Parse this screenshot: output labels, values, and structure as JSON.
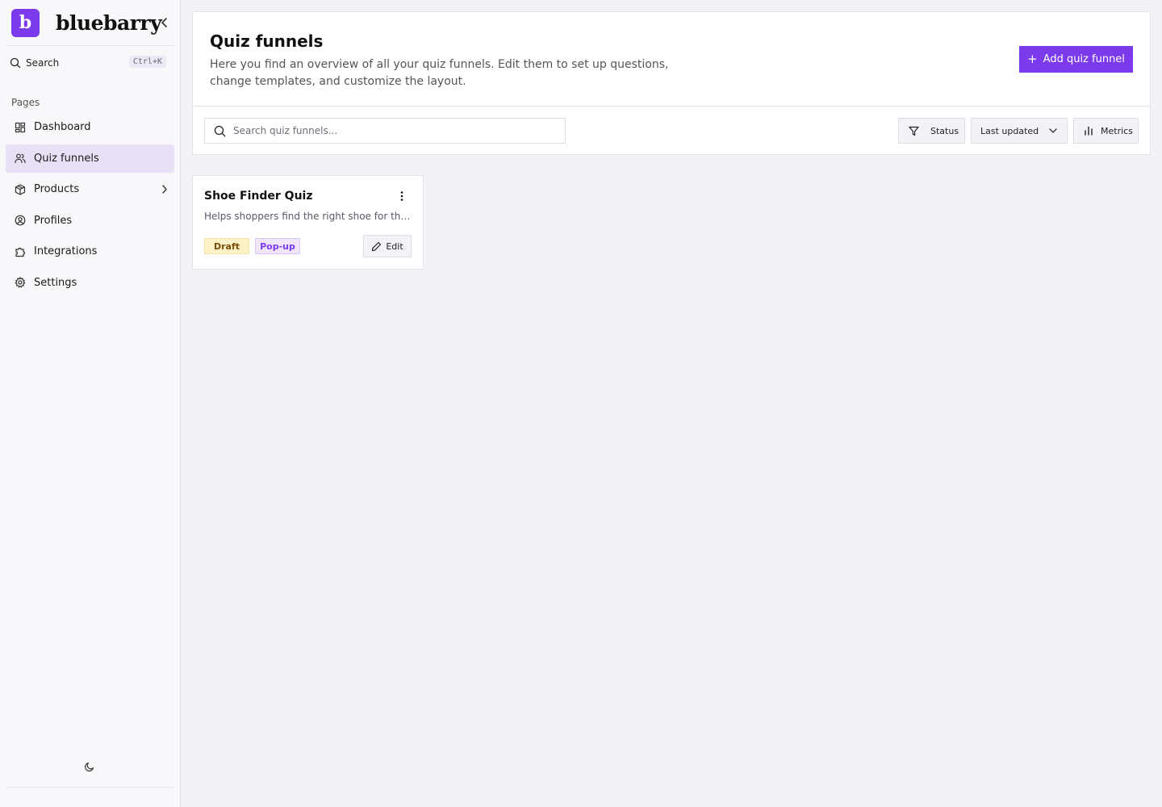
{
  "brand": {
    "logo_letter": "b",
    "name": "bluebarry"
  },
  "sidebar": {
    "search_label": "Search",
    "search_shortcut": "Ctrl+K",
    "section_label": "Pages",
    "items": [
      {
        "label": "Dashboard",
        "icon": "dashboard-icon",
        "active": false
      },
      {
        "label": "Quiz funnels",
        "icon": "users-icon",
        "active": true
      },
      {
        "label": "Products",
        "icon": "package-icon",
        "active": false,
        "has_submenu": true
      },
      {
        "label": "Profiles",
        "icon": "user-circle-icon",
        "active": false
      },
      {
        "label": "Integrations",
        "icon": "puzzle-icon",
        "active": false
      },
      {
        "label": "Settings",
        "icon": "gear-icon",
        "active": false
      }
    ]
  },
  "header": {
    "title": "Quiz funnels",
    "description": "Here you find an overview of all your quiz funnels. Edit them to set up questions, change templates, and customize the layout.",
    "add_button": "Add quiz funnel"
  },
  "toolbar": {
    "search_placeholder": "Search quiz funnels...",
    "status_label": "Status",
    "sort_label": "Last updated",
    "metrics_label": "Metrics"
  },
  "funnels": [
    {
      "title": "Shoe Finder Quiz",
      "description": "Helps shoppers find the right shoe for their needs",
      "status": "Draft",
      "type": "Pop-up",
      "edit_label": "Edit"
    }
  ],
  "colors": {
    "accent": "#7c3aed",
    "active_nav_bg": "#e8e1f6",
    "draft_bg": "#fdf1c7",
    "popup_bg": "#efe6fd"
  }
}
